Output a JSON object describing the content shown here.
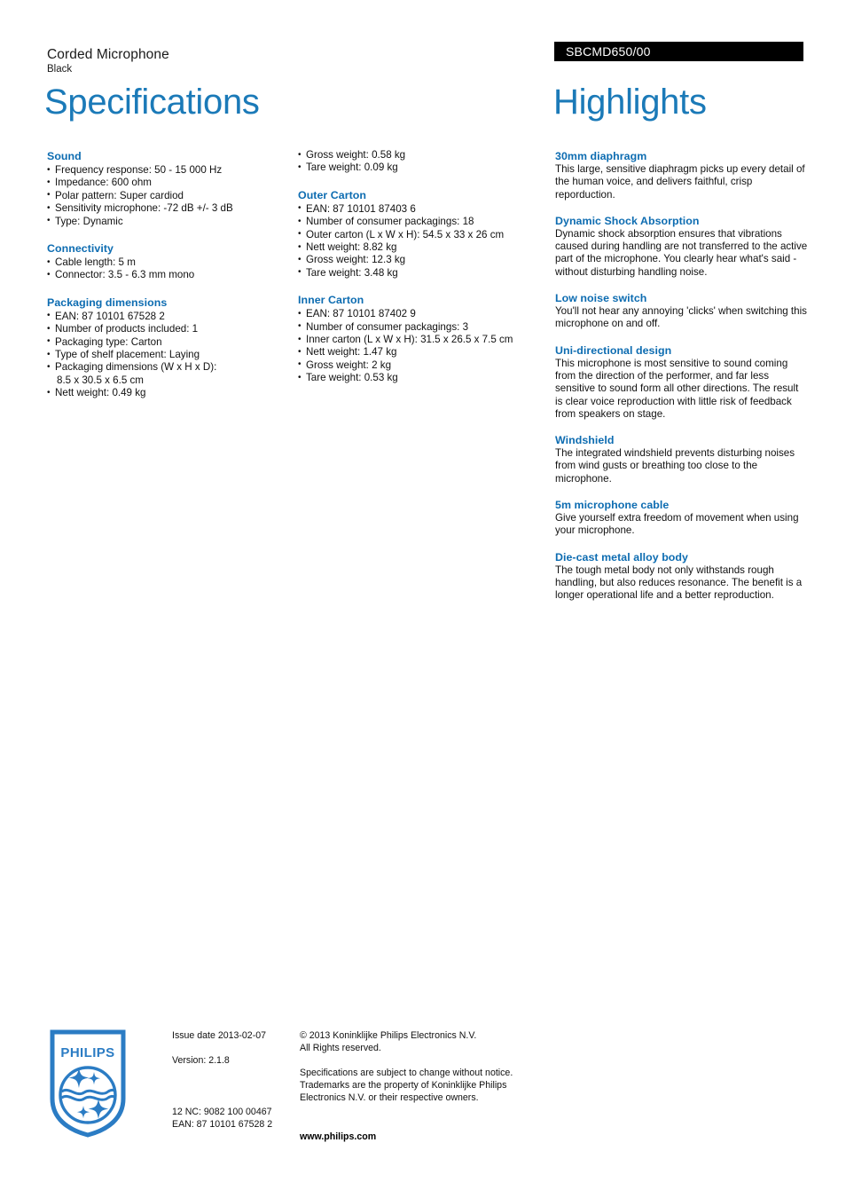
{
  "header": {
    "product_name": "Corded Microphone",
    "product_variant": "Black",
    "model_code": "SBCMD650/00",
    "specs_title": "Specifications",
    "highlights_title": "Highlights"
  },
  "colors": {
    "heading_blue": "#0d6cb1",
    "title_blue": "#1b7ab8",
    "code_bar_background": "#000000",
    "code_bar_text": "#ffffff"
  },
  "specifications": {
    "column_1": [
      {
        "title": "Sound",
        "items": [
          "Frequency response: 50 - 15 000 Hz",
          "Impedance: 600 ohm",
          "Polar pattern: Super cardiod",
          "Sensitivity microphone: -72 dB +/- 3 dB",
          "Type: Dynamic"
        ]
      },
      {
        "title": "Connectivity",
        "items": [
          "Cable length: 5 m",
          "Connector: 3.5 - 6.3 mm mono"
        ]
      },
      {
        "title": "Packaging dimensions",
        "items": [
          "EAN: 87 10101 67528 2",
          "Number of products included: 1",
          "Packaging type: Carton",
          "Type of shelf placement: Laying",
          "Packaging dimensions (W x H x D):",
          "8.5 x 30.5 x 6.5 cm",
          "Nett weight: 0.49 kg"
        ]
      }
    ],
    "column_2": [
      {
        "title": "",
        "items": [
          "Gross weight: 0.58 kg",
          "Tare weight: 0.09 kg"
        ]
      },
      {
        "title": "Outer Carton",
        "items": [
          "EAN: 87 10101 87403 6",
          "Number of consumer packagings: 18",
          "Outer carton (L x W x H): 54.5 x 33 x 26 cm",
          "Nett weight: 8.82 kg",
          "Gross weight: 12.3 kg",
          "Tare weight: 3.48 kg"
        ]
      },
      {
        "title": "Inner Carton",
        "items": [
          "EAN: 87 10101 87402 9",
          "Number of consumer packagings: 3",
          "Inner carton (L x W x H): 31.5 x 26.5 x 7.5 cm",
          "Nett weight: 1.47 kg",
          "Gross weight: 2 kg",
          "Tare weight: 0.53 kg"
        ]
      }
    ]
  },
  "highlights": [
    {
      "title": "30mm diaphragm",
      "body": "This large, sensitive diaphragm picks up every detail of the human voice, and delivers faithful, crisp reporduction."
    },
    {
      "title": "Dynamic Shock Absorption",
      "body": "Dynamic shock absorption ensures that vibrations caused during handling are not transferred to the active part of the microphone. You clearly hear what's said - without disturbing handling noise."
    },
    {
      "title": "Low noise switch",
      "body": "You'll not hear any annoying 'clicks' when switching this microphone on and off."
    },
    {
      "title": "Uni-directional design",
      "body": "This microphone is most sensitive to sound coming from the direction of the performer, and far less sensitive to sound form all other directions. The result is clear voice reproduction with little risk of feedback from speakers on stage."
    },
    {
      "title": "Windshield",
      "body": "The integrated windshield prevents disturbing noises from wind gusts or breathing too close to the microphone."
    },
    {
      "title": "5m microphone cable",
      "body": "Give yourself extra freedom of movement when using your microphone."
    },
    {
      "title": "Die-cast metal alloy body",
      "body": "The tough metal body not only withstands rough handling, but also reduces resonance. The benefit is a longer operational life and a better reproduction."
    }
  ],
  "footer": {
    "logo_wordmark": "PHILIPS",
    "issue_date": "Issue date 2013-02-07",
    "version": "Version: 2.1.8",
    "twelve_nc": "12 NC: 9082 100 00467",
    "ean": "EAN: 87 10101 67528 2",
    "copyright_line_1": "© 2013 Koninklijke Philips Electronics N.V.",
    "copyright_line_2": "All Rights reserved.",
    "disclaimer_line_1": "Specifications are subject to change without notice.",
    "disclaimer_line_2": "Trademarks are the property of Koninklijke Philips",
    "disclaimer_line_3": "Electronics N.V. or their respective owners.",
    "website": "www.philips.com"
  }
}
